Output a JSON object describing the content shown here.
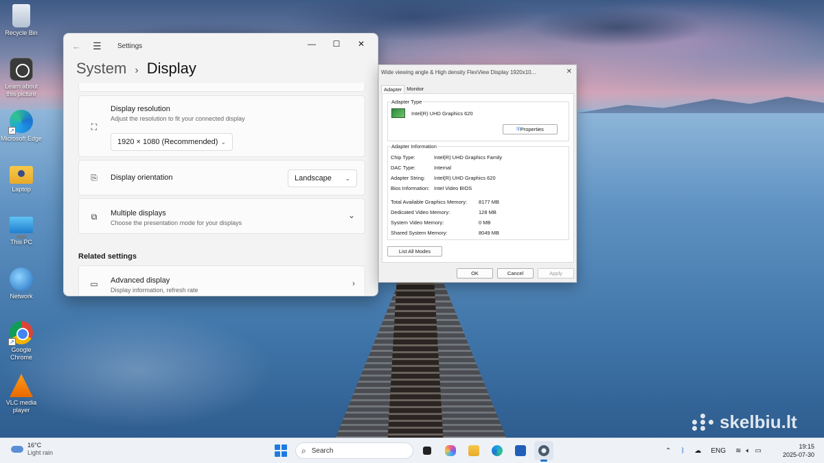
{
  "desktop": {
    "icons": [
      {
        "label": "Recycle Bin",
        "icon": "recycle-bin-icon"
      },
      {
        "label": "Learn about this picture",
        "icon": "learn-picture-icon"
      },
      {
        "label": "Microsoft Edge",
        "icon": "edge-icon"
      },
      {
        "label": "Laptop",
        "icon": "folder-icon"
      },
      {
        "label": "This PC",
        "icon": "monitor-icon"
      },
      {
        "label": "Network",
        "icon": "network-icon"
      },
      {
        "label": "Google Chrome",
        "icon": "chrome-icon"
      },
      {
        "label": "VLC media player",
        "icon": "vlc-icon"
      }
    ],
    "watermark": "skelbiu.lt"
  },
  "settings": {
    "app_title": "Settings",
    "breadcrumb_parent": "System",
    "breadcrumb_current": "Display",
    "resolution": {
      "title": "Display resolution",
      "subtitle": "Adjust the resolution to fit your connected display",
      "value": "1920 × 1080 (Recommended)"
    },
    "orientation": {
      "title": "Display orientation",
      "value": "Landscape"
    },
    "multiple": {
      "title": "Multiple displays",
      "subtitle": "Choose the presentation mode for your displays"
    },
    "related_heading": "Related settings",
    "advanced": {
      "title": "Advanced display",
      "subtitle": "Display information, refresh rate"
    }
  },
  "adapter_dialog": {
    "title": "Wide viewing angle & High density FlexView Display 1920x10...",
    "tabs": [
      "Adapter",
      "Monitor"
    ],
    "adapter_type_legend": "Adapter Type",
    "adapter_name": "Intel(R) UHD Graphics 620",
    "properties_button": "Properties",
    "info_legend": "Adapter Information",
    "info": [
      {
        "label": "Chip Type:",
        "value": "Intel(R) UHD Graphics Family"
      },
      {
        "label": "DAC Type:",
        "value": "Internal"
      },
      {
        "label": "Adapter String:",
        "value": "Intel(R) UHD Graphics 620"
      },
      {
        "label": "Bios Information:",
        "value": "Intel Video BIOS"
      }
    ],
    "memory": [
      {
        "label": "Total Available Graphics Memory:",
        "value": "8177 MB"
      },
      {
        "label": "Dedicated Video Memory:",
        "value": "128 MB"
      },
      {
        "label": "System Video Memory:",
        "value": "0 MB"
      },
      {
        "label": "Shared System Memory:",
        "value": "8049 MB"
      }
    ],
    "list_modes_button": "List All Modes",
    "ok": "OK",
    "cancel": "Cancel",
    "apply": "Apply"
  },
  "taskbar": {
    "weather_temp": "16°C",
    "weather_desc": "Light rain",
    "search_placeholder": "Search",
    "language": "ENG",
    "time": "19:15",
    "date": "2025-07-30"
  }
}
